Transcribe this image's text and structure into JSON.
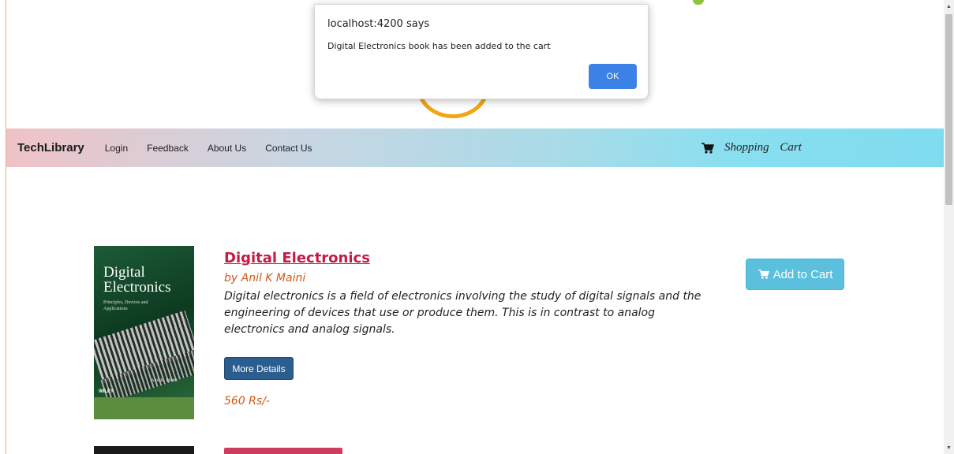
{
  "colors": {
    "accent_title": "#c41b44",
    "accent_orange": "#d05a16",
    "more_button": "#2c5d8f",
    "add_button": "#5bc0de",
    "ok_button": "#3c82e6"
  },
  "alert": {
    "title": "localhost:4200 says",
    "message": "Digital Electronics book has been added to the cart",
    "ok_label": "OK"
  },
  "navbar": {
    "brand": "TechLibrary",
    "links": [
      "Login",
      "Feedback",
      "About Us",
      "Contact Us"
    ],
    "cart_icon": "shopping-cart-icon",
    "cart_label": "Shopping Cart"
  },
  "book": {
    "cover": {
      "title_line1": "Digital",
      "title_line2": "Electronics",
      "subtitle": "Principles, Devices and Applications",
      "author": "Anil K. Maini",
      "publisher": "WILEY"
    },
    "title": "Digital Electronics",
    "author": "by Anil K Maini",
    "description": "Digital electronics is a field of electronics involving the study of digital signals and the engineering of devices that use or produce them. This is in contrast to analog electronics and analog signals.",
    "more_label": "More Details",
    "price": "560 Rs/-",
    "add_label": "Add to Cart",
    "add_icon": "shopping-cart-icon"
  }
}
